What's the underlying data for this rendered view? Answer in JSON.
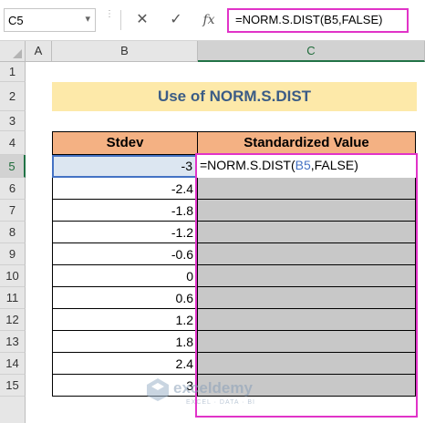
{
  "formula_bar": {
    "name_box": "C5",
    "cancel_icon": "close-icon",
    "enter_icon": "checkmark-icon",
    "fx_label": "fx",
    "formula": "=NORM.S.DIST(B5,FALSE)"
  },
  "columns": [
    "A",
    "B",
    "C"
  ],
  "rows": [
    "1",
    "2",
    "3",
    "4",
    "5",
    "6",
    "7",
    "8",
    "9",
    "10",
    "11",
    "12",
    "13",
    "14",
    "15"
  ],
  "sheet": {
    "title": "Use of NORM.S.DIST",
    "header_b": "Stdev",
    "header_c": "Standardized Value",
    "stdev_values": [
      "-3",
      "-2.4",
      "-1.8",
      "-1.2",
      "-0.6",
      "0",
      "0.6",
      "1.2",
      "1.8",
      "2.4",
      "3"
    ],
    "c5_edit": {
      "prefix": "=NORM.S.DIST(",
      "ref": "B5",
      "suffix": ",FALSE)"
    }
  },
  "colors": {
    "title_fill": "#fde9a9",
    "title_text": "#3b5c86",
    "header_fill": "#f4b183",
    "empty_cell_fill": "#c8c8c8",
    "highlight_border": "#e133c8",
    "selection_border": "#4472c4"
  },
  "watermark": {
    "name": "exceldemy",
    "tagline": "EXCEL · DATA · BI"
  }
}
